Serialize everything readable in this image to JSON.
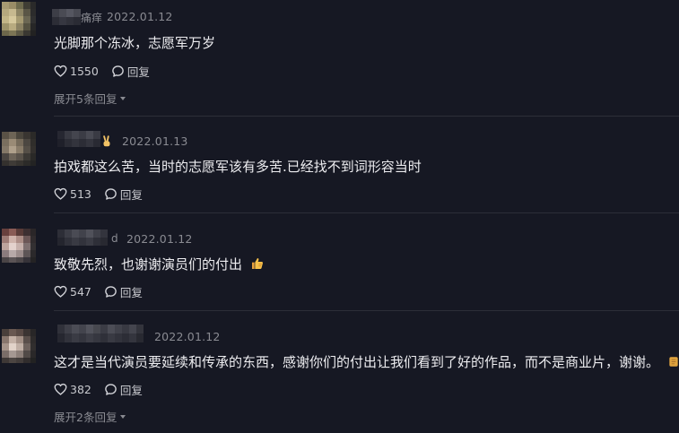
{
  "comments": [
    {
      "name_tail": "痛痒",
      "date": "2022.01.12",
      "text": "光脚那个冻冰，志愿军万岁",
      "likes": "1550",
      "reply_label": "回复",
      "expand_label": "展开5条回复"
    },
    {
      "name_tail": "",
      "date": "2022.01.13",
      "text": "拍戏都这么苦，当时的志愿军该有多苦.已经找不到词形容当时",
      "likes": "513",
      "reply_label": "回复",
      "name_emoji": "victory-hand-icon"
    },
    {
      "name_tail": "d",
      "date": "2022.01.12",
      "text": "致敬先烈，也谢谢演员们的付出",
      "likes": "547",
      "reply_label": "回复",
      "text_emoji": "thumbs-up-icon"
    },
    {
      "name_tail": "",
      "date": "2022.01.12",
      "text": "这才是当代演员要延续和传承的东西，感谢你们的付出让我们看到了好的作品，而不是商业片，谢谢。",
      "likes": "382",
      "reply_label": "回复",
      "text_emoji": "fist-salute-icon",
      "expand_label": "展开2条回复"
    }
  ],
  "colors": {
    "background": "#161823",
    "text": "#ededf0",
    "muted": "#8a8b92",
    "divider": "#2c2e38"
  }
}
